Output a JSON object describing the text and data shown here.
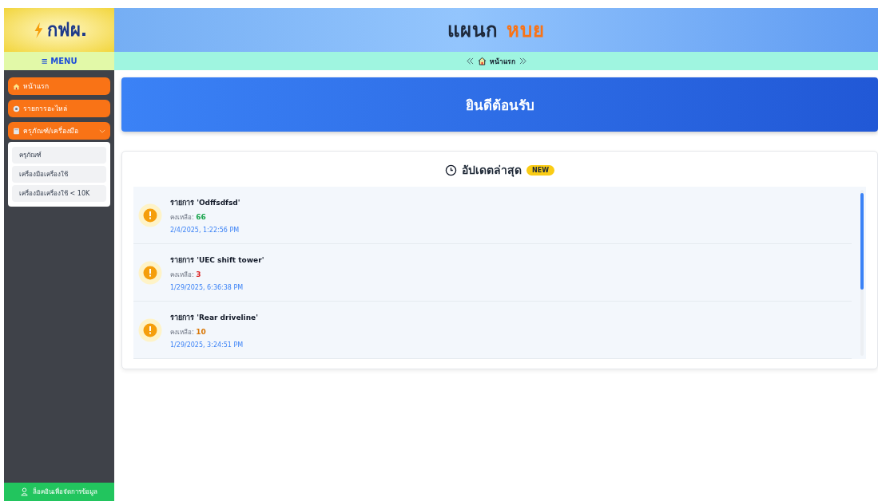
{
  "logo": {
    "text": "กฟผ."
  },
  "menu_label": "≡ MENU",
  "header": {
    "title": "แผนก",
    "title_highlight": "หบย"
  },
  "breadcrumb": {
    "label": "หน้าแรก"
  },
  "sidebar": {
    "items": [
      {
        "label": "หน้าแรก",
        "kind": "home"
      },
      {
        "label": "รายการอะไหล่",
        "kind": "gear"
      },
      {
        "label": "ครุภัณฑ์/เครื่องมือ",
        "kind": "book",
        "expanded": true,
        "children": [
          {
            "label": "ครุภัณฑ์"
          },
          {
            "label": "เครื่องมือเครื่องใช้"
          },
          {
            "label": "เครื่องมือเครื่องใช้ < 10K"
          }
        ]
      }
    ],
    "login": "ล็อคอินเพื่อจัดการข้อมูล"
  },
  "welcome": "ยินดีต้อนรับ",
  "updates": {
    "title": "อัปเดตล่าสุด",
    "badge": "NEW",
    "items": [
      {
        "title": "รายการ 'Odffsdfsd'",
        "remaining_label": "คงเหลือ:",
        "remaining": "66",
        "color": "#16a34a",
        "time": "2/4/2025, 1:22:56 PM"
      },
      {
        "title": "รายการ 'UEC shift tower'",
        "remaining_label": "คงเหลือ:",
        "remaining": "3",
        "color": "#dc2626",
        "time": "1/29/2025, 6:36:38 PM"
      },
      {
        "title": "รายการ 'Rear driveline'",
        "remaining_label": "คงเหลือ:",
        "remaining": "10",
        "color": "#d97706",
        "time": "1/29/2025, 3:24:51 PM"
      }
    ]
  }
}
